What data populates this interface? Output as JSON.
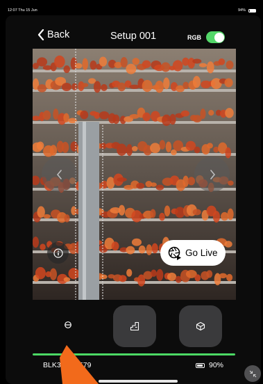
{
  "status_bar": {
    "time": "12:07",
    "date": "Thu 15 Jun",
    "battery": "94%",
    "battery_icon": "battery-icon"
  },
  "header": {
    "back_label": "Back",
    "back_icon": "chevron-left-icon",
    "title": "Setup 001",
    "rgb_label": "RGB",
    "rgb_toggle_on": true
  },
  "camera_view": {
    "prev_icon": "chevron-left-icon",
    "next_icon": "chevron-right-icon",
    "info_icon": "info-icon",
    "go_live": {
      "label": "Go Live",
      "icon": "camera-shutter-play-icon"
    }
  },
  "mode_buttons": [
    {
      "icon": "level-bubble-icon"
    },
    {
      "icon": "floor-plan-icon"
    },
    {
      "icon": "scan-cube-icon"
    }
  ],
  "colors": {
    "accent": "#4cd964",
    "toggle_on": "#53d769",
    "pointer": "#f26a1b"
  },
  "device": {
    "name": "BLK36 061579",
    "battery": "90%",
    "battery_fraction": 0.9,
    "battery_icon": "battery-icon",
    "progress_fraction": 1.0
  },
  "collapse_icon": "collapse-arrows-icon"
}
